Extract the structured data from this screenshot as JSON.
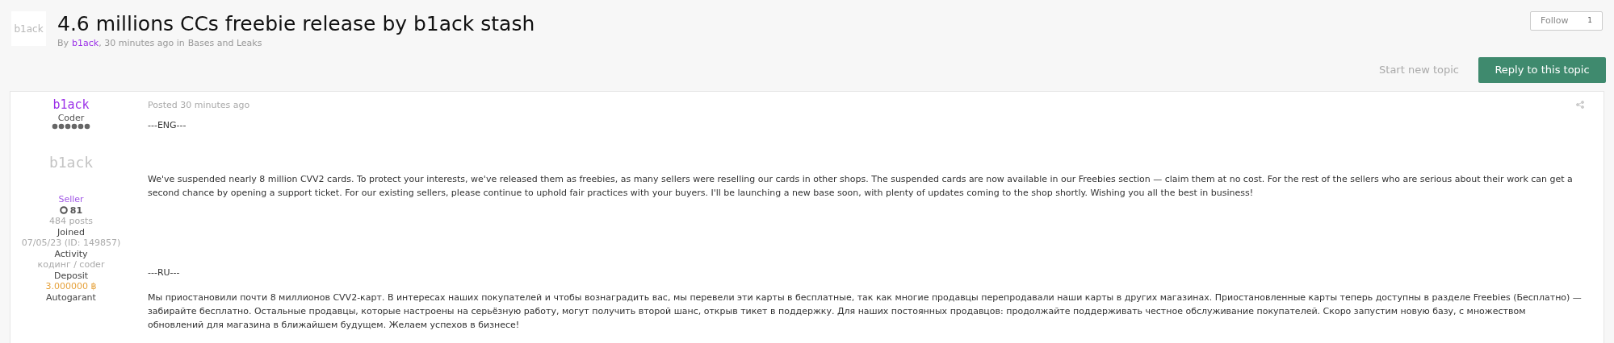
{
  "topic": {
    "avatar_text": "b1ack",
    "title": "4.6 millions CCs freebie release by b1ack stash",
    "by": "By",
    "author": "b1ack",
    "time": ", 30 minutes ago in",
    "forum": "Bases and Leaks"
  },
  "follow": {
    "label": "Follow",
    "count": "1"
  },
  "actions": {
    "start": "Start new topic",
    "reply": "Reply to this topic"
  },
  "post": {
    "author": {
      "name": "b1ack",
      "title": "Coder",
      "avatar_text": "b1ack",
      "group": "Seller",
      "reputation": "81",
      "posts": "484 posts",
      "fields": [
        {
          "label": "Joined",
          "value": "07/05/23 (ID: 149857)",
          "kind": "plain"
        },
        {
          "label": "Activity",
          "value": "кодинг / coder",
          "kind": "plain"
        },
        {
          "label": "Deposit",
          "value": "3.000000 ฿",
          "kind": "money"
        },
        {
          "label": "Autogarant"
        }
      ]
    },
    "posted": "Posted 30 minutes ago",
    "paragraphs": [
      {
        "text": "---ENG---",
        "kind": "heading"
      },
      {
        "text": "We've suspended nearly 8 million CVV2 cards. To protect your interests, we've released them as freebies, as many sellers were reselling our cards in other shops. The suspended cards are now available in our Freebies section — claim them at no cost. For the rest of the sellers who are serious about their work can get a second chance by opening a support ticket. For our existing sellers, please continue to uphold fair practices with your buyers. I'll be launching a new base soon, with plenty of updates coming to the shop shortly. Wishing you all the best in business!",
        "kind": "body"
      },
      {
        "text": "---RU---",
        "kind": "heading"
      },
      {
        "text": "Мы приостановили почти 8 миллионов CVV2-карт. В интересах наших покупателей и чтобы вознаградить вас, мы перевели эти карты в бесплатные, так как многие продавцы перепродавали наши карты в других магазинах. Приостановленные карты теперь доступны в разделе Freebies (Бесплатно) — забирайте бесплатно. Остальные продавцы, которые настроены на серьёзную работу, могут получить второй шанс, открыв тикет в поддержку. Для наших постоянных продавцов: продолжайте поддерживать честное обслуживание покупателей. Скоро запустим новую базу, с множеством обновлений для магазина в ближайшем будущем. Желаем успехов в бизнесе!",
        "kind": "body"
      }
    ]
  }
}
